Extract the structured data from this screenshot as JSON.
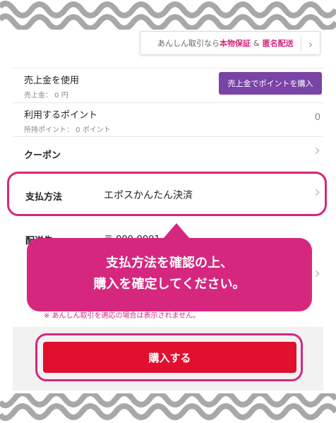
{
  "promo": {
    "prefix": "あんしん取引なら",
    "item_a": "本物保証",
    "separator": "&",
    "item_b": "匿名配送",
    "chevron": "›"
  },
  "sales": {
    "title": "売上金を使用",
    "sub": "売上金：  0 円",
    "button": "売上金でポイントを購入"
  },
  "points": {
    "title": "利用するポイント",
    "sub": "所持ポイント：  0 ポイント",
    "value": "0"
  },
  "coupon": {
    "title": "クーポン",
    "chevron": "›"
  },
  "payment": {
    "label": "支払方法",
    "value": "エポスかんたん決済",
    "chevron": "›"
  },
  "shipping": {
    "label": "配送先",
    "zip": "〒 000-0001",
    "chevron": "›"
  },
  "note": "※ あんしん取引を適応の場合は表示されません。",
  "callout": {
    "line1": "支払方法を確認の上、",
    "line2": "購入を確定してください。"
  },
  "buy": {
    "label": "購入する"
  },
  "colors": {
    "accent": "#d6277f",
    "buy": "#e0102e",
    "purple": "#7a43a8"
  }
}
